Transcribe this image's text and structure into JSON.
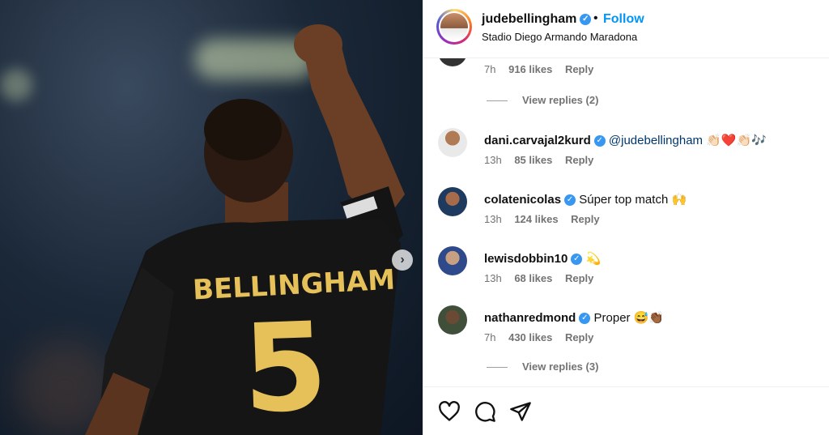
{
  "post": {
    "photo_text": {
      "jersey_name": "BELLINGHAM",
      "jersey_number": "5"
    }
  },
  "header": {
    "username": "judebellingham",
    "separator": "•",
    "follow_label": "Follow",
    "location": "Stadio Diego Armando Maradona"
  },
  "top_meta": {
    "time": "7h",
    "likes": "916 likes",
    "reply": "Reply"
  },
  "view_replies_1": "View replies (2)",
  "comments": [
    {
      "username": "dani.carvajal2kurd",
      "text": "@judebellingham 👏🏻❤️👏🏻🎶",
      "time": "13h",
      "likes": "85 likes",
      "reply": "Reply"
    },
    {
      "username": "colatenicolas",
      "text": "Súper top match 🙌",
      "time": "13h",
      "likes": "124 likes",
      "reply": "Reply"
    },
    {
      "username": "lewisdobbin10",
      "text": "💫",
      "time": "13h",
      "likes": "68 likes",
      "reply": "Reply"
    },
    {
      "username": "nathanredmond",
      "text": "Proper 😅👏🏾",
      "time": "7h",
      "likes": "430 likes",
      "reply": "Reply"
    }
  ],
  "view_replies_2": "View replies (3)",
  "icons": {
    "verified": "verified-badge-icon",
    "like": "heart-icon",
    "comment": "comment-icon",
    "share": "share-icon",
    "next": "chevron-right-icon"
  },
  "colors": {
    "accent": "#0095f6",
    "verified": "#3897f0",
    "jersey_gold": "#e6c15a"
  }
}
